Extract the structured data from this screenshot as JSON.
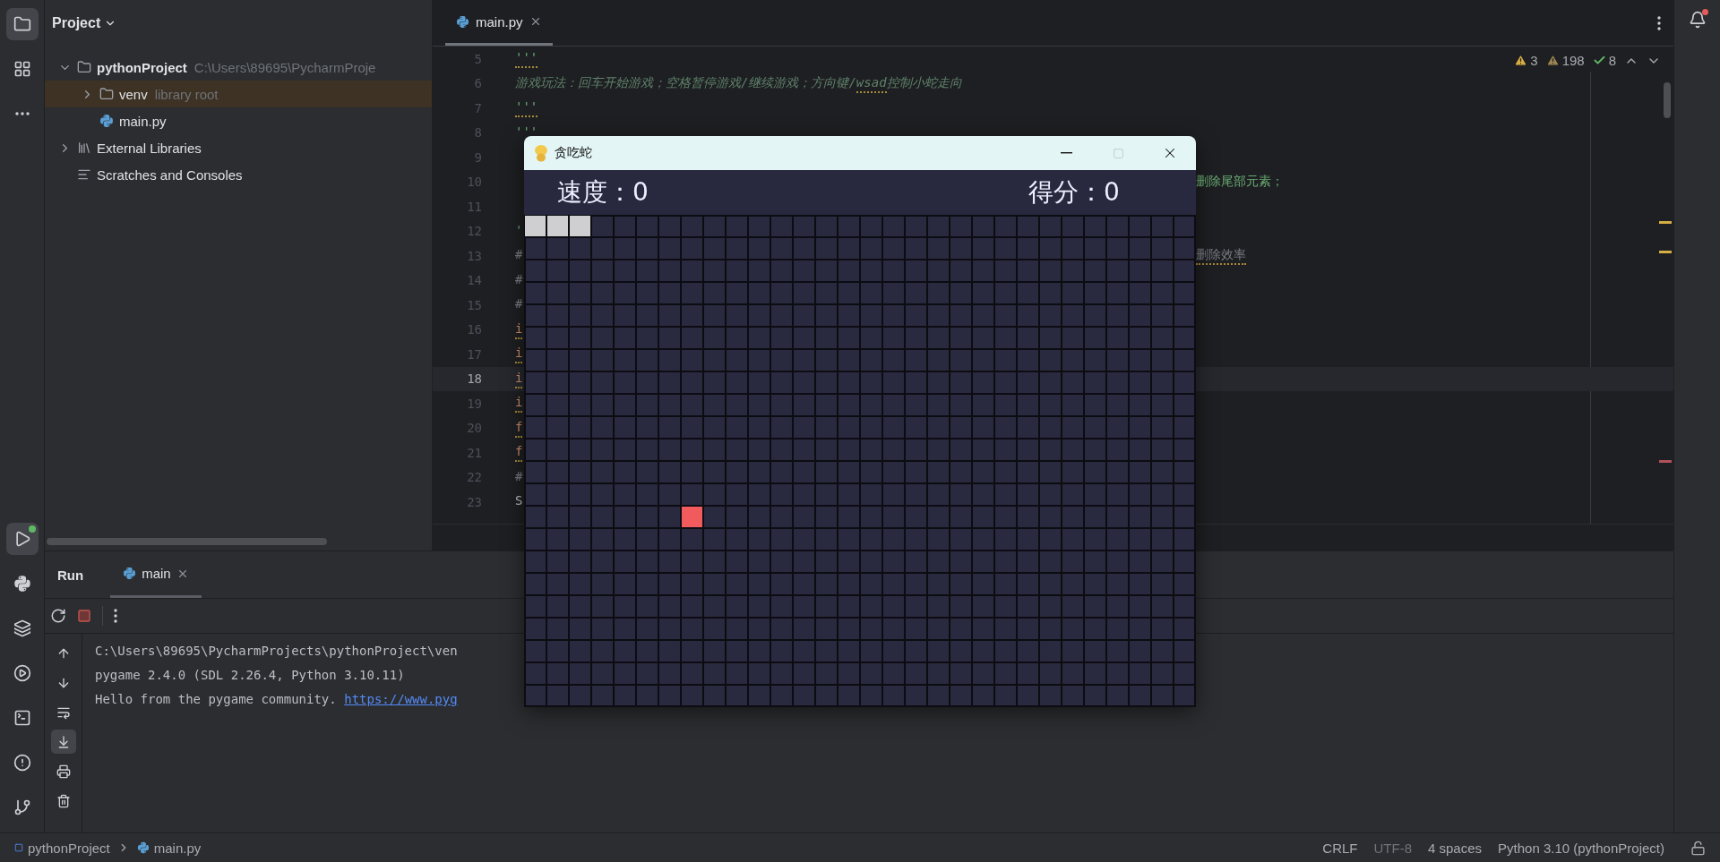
{
  "tool_strip_top": [
    {
      "kind": "project",
      "selected": true
    },
    {
      "kind": "structure",
      "selected": false
    },
    {
      "kind": "more",
      "selected": false
    }
  ],
  "tool_strip_bottom": [
    {
      "kind": "run",
      "selected": true
    },
    {
      "kind": "python_console",
      "selected": false
    },
    {
      "kind": "packages",
      "selected": false
    },
    {
      "kind": "services",
      "selected": false
    },
    {
      "kind": "terminal",
      "selected": false
    },
    {
      "kind": "problems",
      "selected": false
    },
    {
      "kind": "git",
      "selected": false
    }
  ],
  "project_panel": {
    "title": "Project",
    "tree": [
      {
        "name": "pythonProject",
        "kind": "folder",
        "hint": "C:\\Users\\89695\\PycharmProje",
        "expanded": true,
        "selected": false,
        "children": [
          {
            "name": "venv",
            "kind": "folder",
            "hint": "library root",
            "expanded": false,
            "selected": true
          },
          {
            "name": "main.py",
            "kind": "python",
            "selected": false
          }
        ]
      },
      {
        "name": "External Libraries",
        "kind": "libraries",
        "expanded": false,
        "selected": false
      },
      {
        "name": "Scratches and Consoles",
        "kind": "scratches",
        "selected": false
      }
    ]
  },
  "editor": {
    "tabs": [
      {
        "label": "main.py",
        "selected": true
      }
    ],
    "inspections": [
      {
        "kind": "warning",
        "count": "3"
      },
      {
        "kind": "weak_warning",
        "count": "198"
      },
      {
        "kind": "typo",
        "count": "8"
      }
    ],
    "lines": [
      {
        "number": "5",
        "current": false,
        "left": [
          {
            "text": "'''",
            "kind": "string",
            "underlined": true
          }
        ]
      },
      {
        "number": "6",
        "current": false,
        "left": [
          {
            "text": "游戏玩法：回车开始游戏；空格暂停游戏/继续游戏；方向键/",
            "kind": "docstring",
            "underlined": false
          },
          {
            "text": "wsad",
            "kind": "docstring",
            "underlined": true
          },
          {
            "text": "控制小蛇走向",
            "kind": "docstring",
            "underlined": false
          }
        ]
      },
      {
        "number": "7",
        "current": false,
        "left": [
          {
            "text": "'''",
            "kind": "string",
            "underlined": true
          }
        ]
      },
      {
        "number": "8",
        "current": false,
        "left": [
          {
            "text": "'''",
            "kind": "string",
            "underlined": false
          }
        ]
      },
      {
        "number": "9",
        "current": false
      },
      {
        "number": "10",
        "current": false,
        "right": [
          {
            "text": "删除尾部元素；",
            "kind": "string",
            "underlined": false
          }
        ]
      },
      {
        "number": "11",
        "current": false
      },
      {
        "number": "12",
        "current": false,
        "left": [
          {
            "text": "'",
            "kind": "string",
            "underlined": false
          }
        ]
      },
      {
        "number": "13",
        "current": false,
        "left": [
          {
            "text": "#",
            "kind": "comment",
            "underlined": false
          }
        ],
        "right": [
          {
            "text": "删除效率",
            "kind": "comment",
            "underlined": true
          }
        ]
      },
      {
        "number": "14",
        "current": false,
        "left": [
          {
            "text": "#",
            "kind": "comment",
            "underlined": false
          }
        ]
      },
      {
        "number": "15",
        "current": false,
        "left": [
          {
            "text": "#",
            "kind": "comment",
            "underlined": false
          }
        ]
      },
      {
        "number": "16",
        "current": false,
        "left": [
          {
            "text": "i",
            "kind": "keyword",
            "underlined": true
          }
        ]
      },
      {
        "number": "17",
        "current": false,
        "left": [
          {
            "text": "i",
            "kind": "keyword",
            "underlined": true
          }
        ]
      },
      {
        "number": "18",
        "current": true,
        "left": [
          {
            "text": "i",
            "kind": "keyword",
            "underlined": true
          }
        ]
      },
      {
        "number": "19",
        "current": false,
        "left": [
          {
            "text": "i",
            "kind": "keyword",
            "underlined": true
          }
        ]
      },
      {
        "number": "20",
        "current": false,
        "left": [
          {
            "text": "f",
            "kind": "keyword",
            "underlined": true
          }
        ]
      },
      {
        "number": "21",
        "current": false,
        "left": [
          {
            "text": "f",
            "kind": "keyword",
            "underlined": true
          }
        ]
      },
      {
        "number": "22",
        "current": false,
        "left": [
          {
            "text": "#",
            "kind": "comment",
            "underlined": false
          }
        ]
      },
      {
        "number": "23",
        "current": false,
        "left": [
          {
            "text": "S",
            "kind": "plain",
            "underlined": false
          }
        ]
      }
    ]
  },
  "game_window": {
    "title": "贪吃蛇",
    "controls": [
      {
        "kind": "minimize",
        "disabled": false
      },
      {
        "kind": "maximize",
        "disabled": true
      },
      {
        "kind": "close",
        "disabled": false
      }
    ],
    "speed": "速度：0",
    "score": "得分：0"
  },
  "run_panel": {
    "title": "Run",
    "tabs": [
      {
        "label": "main",
        "selected": true
      }
    ],
    "side_tools": [
      {
        "kind": "up",
        "selected": false
      },
      {
        "kind": "down",
        "selected": false
      },
      {
        "kind": "wrap",
        "selected": false
      },
      {
        "kind": "scroll_end",
        "selected": true
      },
      {
        "kind": "print",
        "selected": false
      },
      {
        "kind": "clear",
        "selected": false
      }
    ],
    "console": [
      [
        {
          "text": "C:\\Users\\89695\\PycharmProjects\\pythonProject\\ven",
          "kind": "plain"
        }
      ],
      [
        {
          "text": "pygame 2.4.0 (SDL 2.26.4, Python 3.10.11)",
          "kind": "plain"
        }
      ],
      [
        {
          "text": "Hello from the pygame community.",
          "kind": "plain"
        },
        {
          "text": "https://www.pyg",
          "kind": "link"
        }
      ]
    ]
  },
  "status_bar": {
    "breadcrumbs": [
      {
        "label": "pythonProject",
        "kind": "project"
      },
      {
        "label": "main.py",
        "kind": "python"
      }
    ],
    "items": [
      {
        "label": "CRLF",
        "disabled": false
      },
      {
        "label": "UTF-8",
        "disabled": true
      },
      {
        "label": "4 spaces",
        "disabled": false
      },
      {
        "label": "Python 3.10 (pythonProject)",
        "disabled": false
      }
    ]
  }
}
